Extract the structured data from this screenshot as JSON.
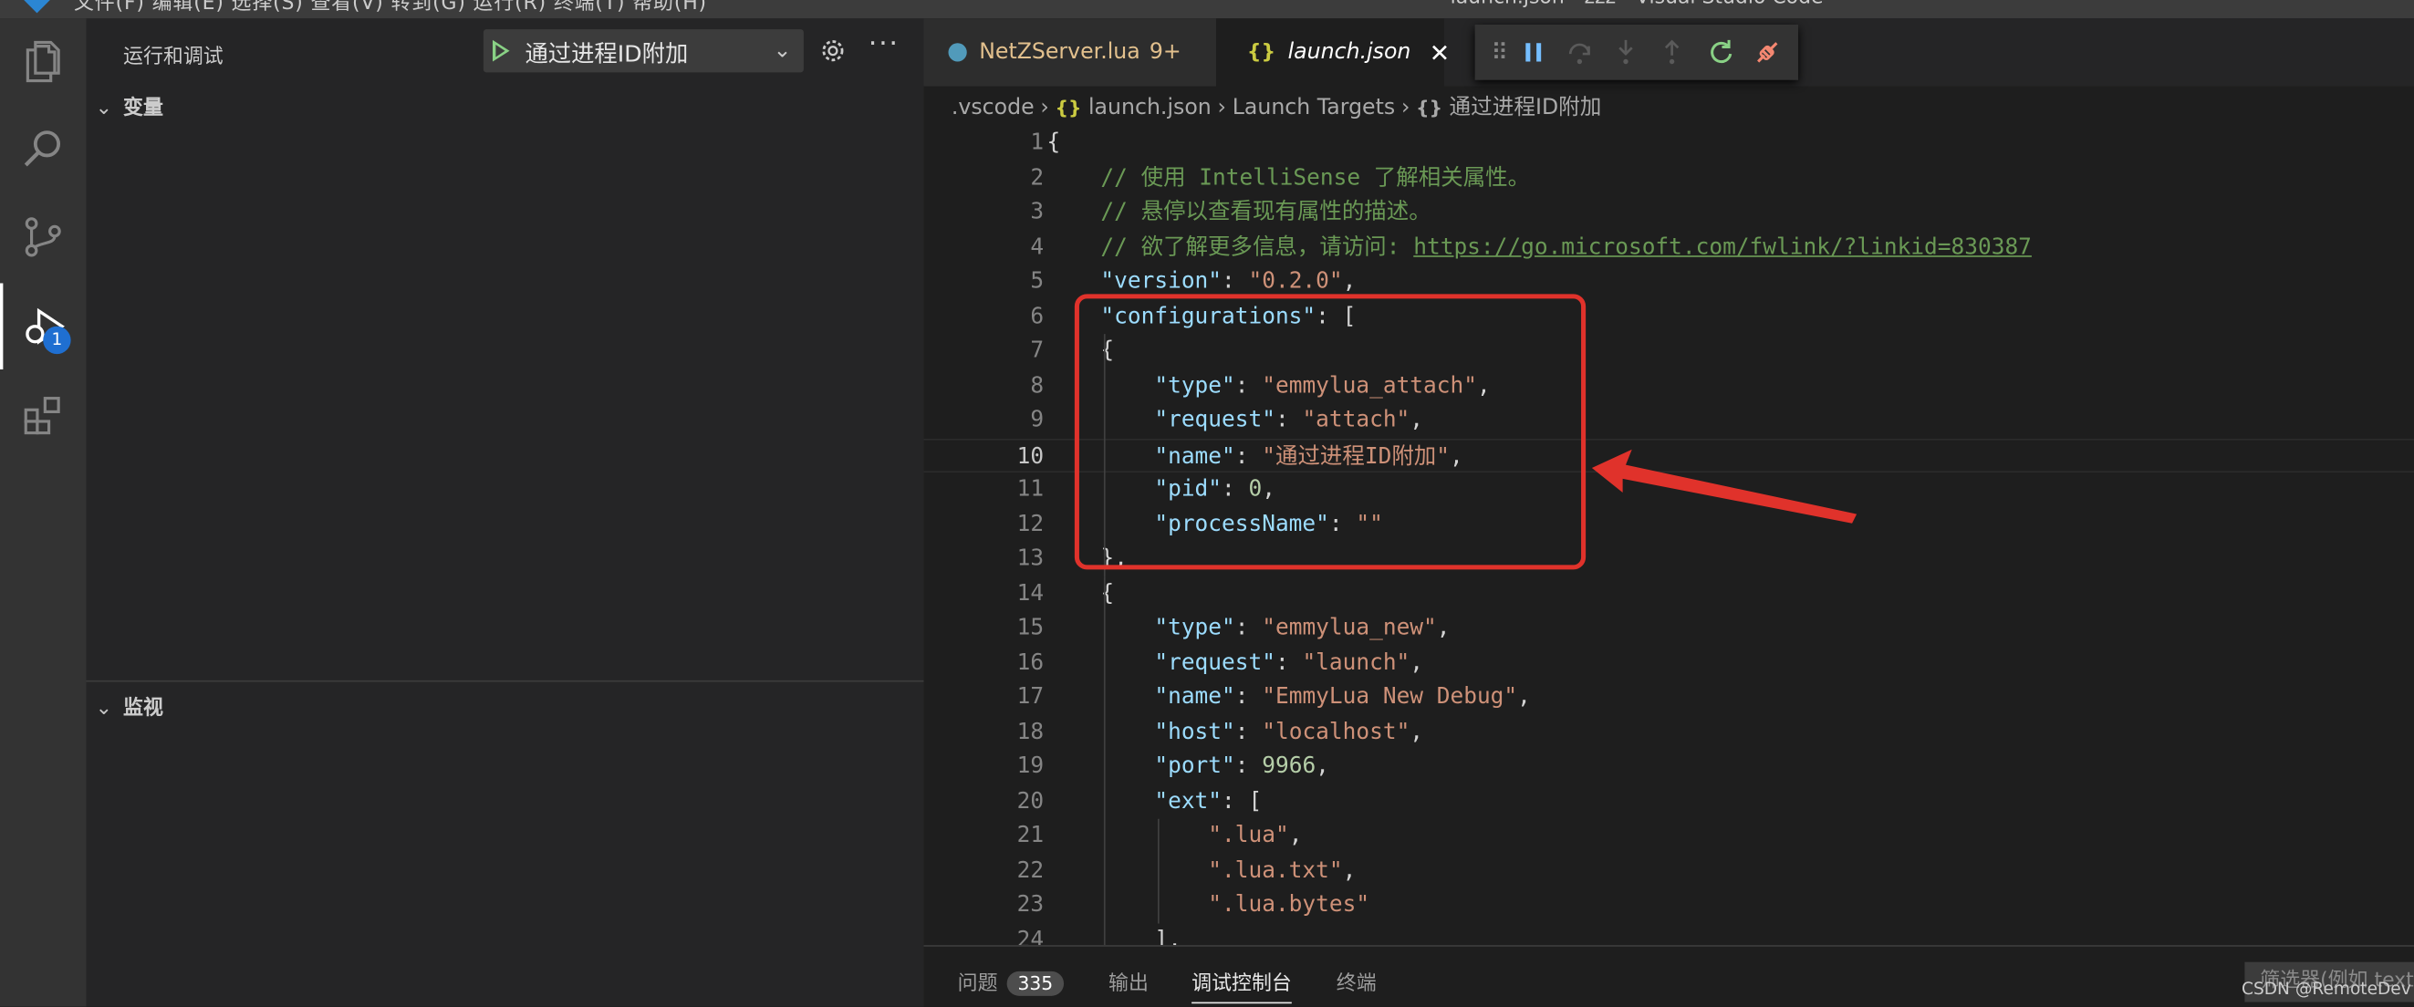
{
  "titlebar": {
    "menu": "文件(F)  编辑(E)  选择(S)  查看(V)  转到(G)  运行(R)  终端(T)  帮助(H)",
    "window_title": "launch.json - zzz - Visual Studio Code"
  },
  "activity_bar": {
    "items": [
      "explorer-icon",
      "search-icon",
      "source-control-icon",
      "run-debug-icon",
      "extensions-icon"
    ],
    "debug_badge": "1"
  },
  "sidebar": {
    "title": "运行和调试",
    "run_config": "通过进程ID附加",
    "sections": {
      "variables": "变量",
      "watch": "监视"
    }
  },
  "tabs": [
    {
      "label": "NetZServer.lua",
      "badge": "9+"
    },
    {
      "label": "launch.json",
      "icon": "{}"
    }
  ],
  "debug_toolbar": [
    "drag-grip-icon",
    "pause-icon",
    "step-over-icon",
    "step-into-icon",
    "step-out-icon",
    "restart-icon",
    "disconnect-icon"
  ],
  "breadcrumb": {
    "folder": ".vscode",
    "file": "launch.json",
    "section": "Launch Targets",
    "item": "通过进程ID附加",
    "icon": "{}"
  },
  "code": {
    "current_line": 10,
    "lines": [
      {
        "n": "1",
        "t": "{"
      },
      {
        "n": "2",
        "t": "    // 使用 IntelliSense 了解相关属性。"
      },
      {
        "n": "3",
        "t": "    // 悬停以查看现有属性的描述。"
      },
      {
        "n": "4",
        "t": "    // 欲了解更多信息，请访问: ",
        "url": "https://go.microsoft.com/fwlink/?linkid=830387"
      },
      {
        "n": "5",
        "t": "    \"version\": \"0.2.0\","
      },
      {
        "n": "6",
        "t": "    \"configurations\": ["
      },
      {
        "n": "7",
        "t": "    {"
      },
      {
        "n": "8",
        "t": "        \"type\": \"emmylua_attach\","
      },
      {
        "n": "9",
        "t": "        \"request\": \"attach\","
      },
      {
        "n": "10",
        "t": "        \"name\": \"通过进程ID附加\","
      },
      {
        "n": "11",
        "t": "        \"pid\": 0,"
      },
      {
        "n": "12",
        "t": "        \"processName\": \"\""
      },
      {
        "n": "13",
        "t": "    },"
      },
      {
        "n": "14",
        "t": "    {"
      },
      {
        "n": "15",
        "t": "        \"type\": \"emmylua_new\","
      },
      {
        "n": "16",
        "t": "        \"request\": \"launch\","
      },
      {
        "n": "17",
        "t": "        \"name\": \"EmmyLua New Debug\","
      },
      {
        "n": "18",
        "t": "        \"host\": \"localhost\","
      },
      {
        "n": "19",
        "t": "        \"port\": 9966,"
      },
      {
        "n": "20",
        "t": "        \"ext\": ["
      },
      {
        "n": "21",
        "t": "            \".lua\","
      },
      {
        "n": "22",
        "t": "            \".lua.txt\","
      },
      {
        "n": "23",
        "t": "            \".lua.bytes\""
      },
      {
        "n": "24",
        "t": "        ],"
      }
    ]
  },
  "panel": {
    "tabs": [
      "问题",
      "输出",
      "调试控制台",
      "终端"
    ],
    "problems_count": "335",
    "active_tab": "调试控制台",
    "filter_placeholder": "筛选器(例如 text"
  },
  "watermark": "CSDN @RemoteDev",
  "colors": {
    "annotation_red": "#e0322b",
    "accent_blue": "#1f6fd1"
  }
}
